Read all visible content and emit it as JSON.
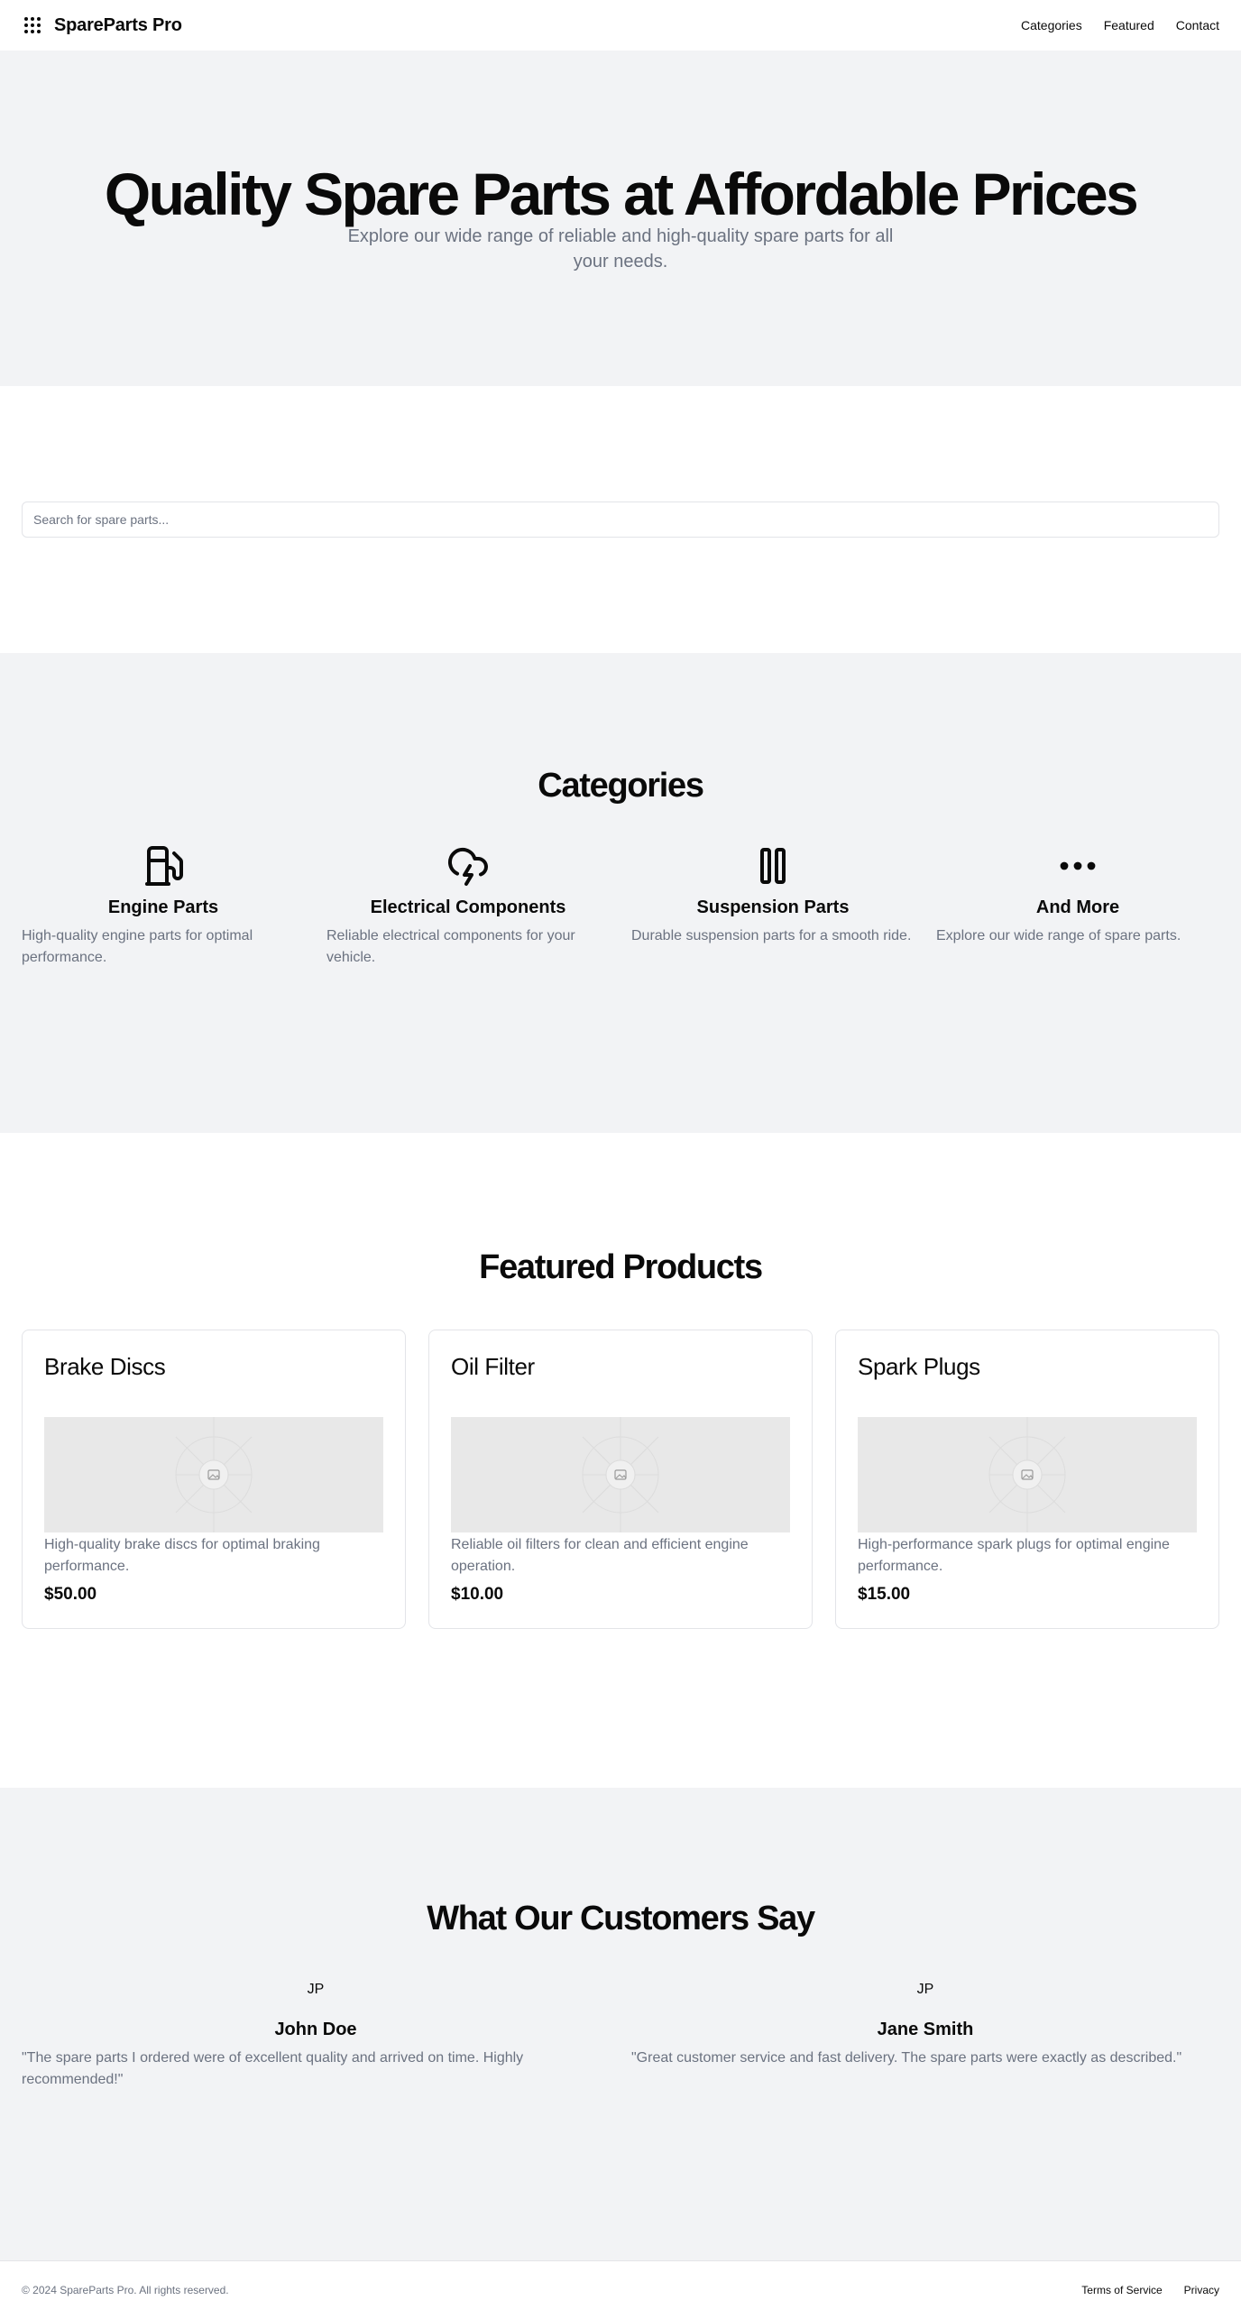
{
  "header": {
    "brand_name": "SpareParts Pro",
    "brand_icon": "grid-dots-icon",
    "nav": [
      "Categories",
      "Featured",
      "Contact"
    ]
  },
  "hero": {
    "title": "Quality Spare Parts at Affordable Prices",
    "subtitle": "Explore our wide range of reliable and high-quality spare parts for all your needs."
  },
  "search": {
    "placeholder": "Search for spare parts...",
    "value": ""
  },
  "categories": {
    "title": "Categories",
    "items": [
      {
        "icon": "fuel-pump-icon",
        "title": "Engine Parts",
        "description": "High-quality engine parts for optimal performance."
      },
      {
        "icon": "cloud-lightning-icon",
        "title": "Electrical Components",
        "description": "Reliable electrical components for your vehicle."
      },
      {
        "icon": "pause-bars-icon",
        "title": "Suspension Parts",
        "description": "Durable suspension parts for a smooth ride."
      },
      {
        "icon": "more-dots-icon",
        "title": "And More",
        "description": "Explore our wide range of spare parts."
      }
    ]
  },
  "featured": {
    "title": "Featured Products",
    "products": [
      {
        "name": "Brake Discs",
        "description": "High-quality brake discs for optimal braking performance.",
        "price": "$50.00"
      },
      {
        "name": "Oil Filter",
        "description": "Reliable oil filters for clean and efficient engine operation.",
        "price": "$10.00"
      },
      {
        "name": "Spark Plugs",
        "description": "High-performance spark plugs for optimal engine performance.",
        "price": "$15.00"
      }
    ]
  },
  "testimonials": {
    "title": "What Our Customers Say",
    "items": [
      {
        "avatar": "JP",
        "name": "John Doe",
        "quote": "\"The spare parts I ordered were of excellent quality and arrived on time. Highly recommended!\""
      },
      {
        "avatar": "JP",
        "name": "Jane Smith",
        "quote": "\"Great customer service and fast delivery. The spare parts were exactly as described.\""
      }
    ]
  },
  "footer": {
    "copyright": "© 2024 SpareParts Pro. All rights reserved.",
    "links": [
      "Terms of Service",
      "Privacy"
    ]
  },
  "colors": {
    "text": "#0a0a0a",
    "muted": "#6b7280",
    "section_bg": "#f2f3f5",
    "border": "#e3e4e8",
    "placeholder_bg": "#e8e8e8"
  }
}
